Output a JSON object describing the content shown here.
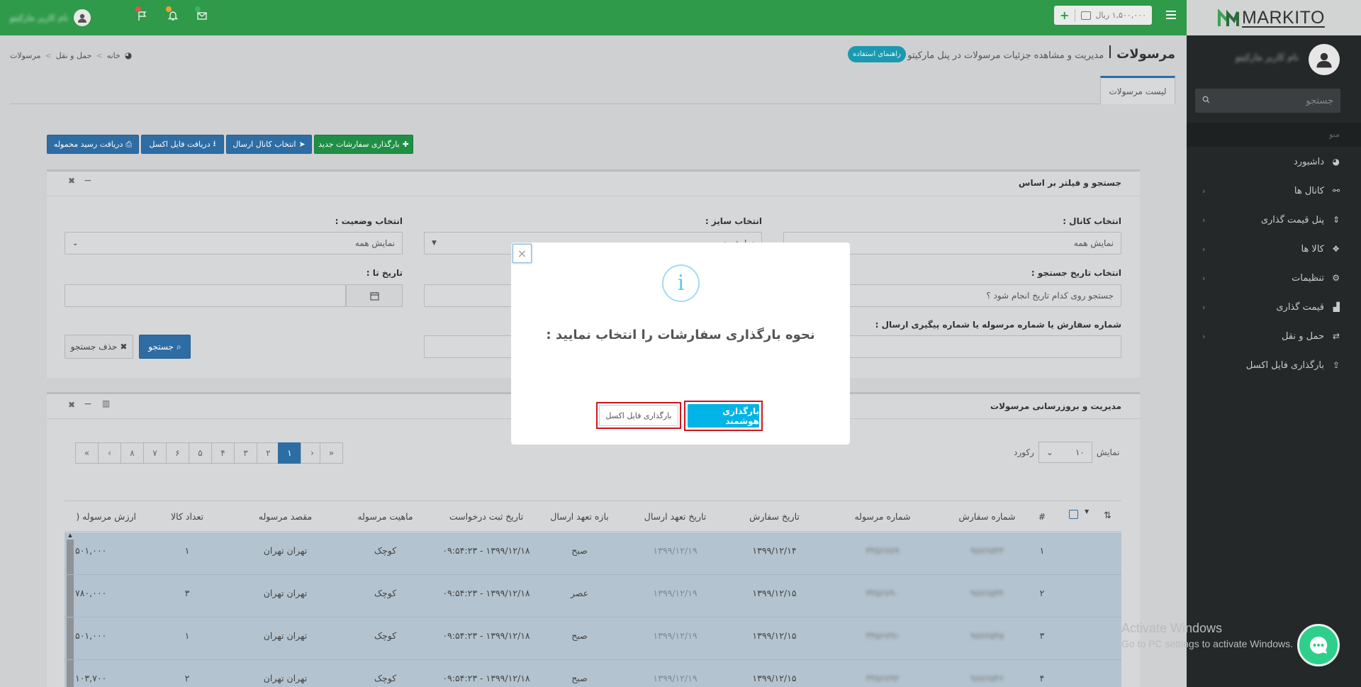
{
  "app": {
    "brand": "MARKITO"
  },
  "topbar": {
    "wallet_label": "۱,۵۰۰,۰۰۰ ریال",
    "user_name": "نام کاربر مارکیتو"
  },
  "sidebar": {
    "user_name": "نام کاربر مارکیتو",
    "search_placeholder": "جستجو",
    "menu_heading": "منو",
    "items": [
      {
        "label": "داشبورد",
        "icon": "dashboard-icon"
      },
      {
        "label": "کانال ها",
        "icon": "link-icon"
      },
      {
        "label": "پنل قیمت گذاری",
        "icon": "sort-icon"
      },
      {
        "label": "کالا ها",
        "icon": "cubes-icon"
      },
      {
        "label": "تنظیمات",
        "icon": "gear-icon"
      },
      {
        "label": "قیمت گذاری",
        "icon": "chart-icon"
      },
      {
        "label": "حمل و نقل",
        "icon": "exchange-icon"
      },
      {
        "label": "بارگذاری فایل اکسل",
        "icon": "upload-icon"
      }
    ]
  },
  "page": {
    "title": "مرسولات",
    "subtitle": "مدیریت و مشاهده جزئیات مرسولات در پنل مارکیتو",
    "guide_button": "راهنمای استفاده",
    "breadcrumb": [
      "خانه",
      "حمل و نقل",
      "مرسولات"
    ],
    "tab": "لیست مرسولات"
  },
  "toolbar": {
    "upload_new": "بارگذاری سفارشات جدید",
    "select_channel": "انتخاب کانال ارسال",
    "download_excel": "دریافت فایل اکسل",
    "download_receipt": "دریافت رسید محموله"
  },
  "filter": {
    "title": "جستجو و فیلتر بر اساس",
    "channel_label": "انتخاب کانال :",
    "channel_value": "نمایش همه",
    "size_label": "انتخاب سایز :",
    "size_value": "نمایش همه",
    "status_label": "انتخاب وضعیت :",
    "status_value": "نمایش همه",
    "date_search_label": "انتخاب تاریخ جستجو :",
    "date_search_value": "جستجو روی کدام تاریخ انجام شود ؟",
    "date_to_label": "تاریخ تا :",
    "order_search_label": "شماره سفارش یا شماره مرسوله یا شماره پیگیری ارسال :",
    "search_button": "جستجو",
    "clear_button": "حذف جستجو"
  },
  "table_panel": {
    "title": "مدیریت و بروزرسانی مرسولات",
    "show_label": "نمایش",
    "page_size": "۱۰",
    "records_label": "رکورد",
    "pages": [
      "«",
      "‹",
      "۱",
      "۲",
      "۳",
      "۴",
      "۵",
      "۶",
      "۷",
      "۸",
      "›",
      "»"
    ],
    "headers": [
      "#",
      "شماره سفارش",
      "شماره مرسوله",
      "تاریخ سفارش",
      "تاریخ تعهد ارسال",
      "بازه تعهد ارسال",
      "تاریخ ثبت درخواست",
      "ماهیت مرسوله",
      "مقصد مرسوله",
      "تعداد کالا",
      "ارزش مرسوله ("
    ],
    "rows": [
      {
        "n": "۱",
        "order": "۹۸۷۶۵۴۳",
        "parcel": "۳۴۵۶۷۸۹",
        "order_date": "۱۳۹۹/۱۲/۱۴",
        "commit_date": "۱۳۹۹/۱۲/۱۹",
        "window": "صبح",
        "req_date": "۱۳۹۹/۱۲/۱۸ - ۰۹:۵۴:۲۳",
        "kind": "کوچک",
        "dest": "تهران تهران",
        "qty": "۱",
        "value": "۵۰۱,۰۰۰"
      },
      {
        "n": "۲",
        "order": "۹۸۷۶۵۴۴",
        "parcel": "۳۴۵۶۷۹۰",
        "order_date": "۱۳۹۹/۱۲/۱۵",
        "commit_date": "۱۳۹۹/۱۲/۱۹",
        "window": "عصر",
        "req_date": "۱۳۹۹/۱۲/۱۸ - ۰۹:۵۴:۲۳",
        "kind": "کوچک",
        "dest": "تهران تهران",
        "qty": "۳",
        "value": "۷۸۰,۰۰۰"
      },
      {
        "n": "۳",
        "order": "۹۸۷۶۵۴۵",
        "parcel": "۳۴۵۶۷۹۱",
        "order_date": "۱۳۹۹/۱۲/۱۵",
        "commit_date": "۱۳۹۹/۱۲/۱۹",
        "window": "صبح",
        "req_date": "۱۳۹۹/۱۲/۱۸ - ۰۹:۵۴:۲۳",
        "kind": "کوچک",
        "dest": "تهران تهران",
        "qty": "۱",
        "value": "۵۰۱,۰۰۰"
      },
      {
        "n": "۴",
        "order": "۹۸۷۶۵۴۶",
        "parcel": "۳۴۵۶۷۹۲",
        "order_date": "۱۳۹۹/۱۲/۱۵",
        "commit_date": "۱۳۹۹/۱۲/۱۹",
        "window": "صبح",
        "req_date": "۱۳۹۹/۱۲/۱۸ - ۰۹:۵۴:۲۳",
        "kind": "کوچک",
        "dest": "تهران تهران",
        "qty": "۲",
        "value": "۱۰۳,۷۰۰"
      }
    ]
  },
  "modal": {
    "message": "نحوه بارگذاری سفارشات را انتخاب نمایید :",
    "smart_button": "بارگذاری هوشمند",
    "excel_button": "بارگذاری فایل اکسل"
  },
  "watermark": {
    "line1": "Activate Windows",
    "line2": "Go to PC settings to activate Windows."
  },
  "colors": {
    "topbar": "#2f9a4a",
    "primary": "#2e6da4",
    "success": "#1f9b4b",
    "info": "#00b4e6",
    "sidebar": "#242829"
  }
}
